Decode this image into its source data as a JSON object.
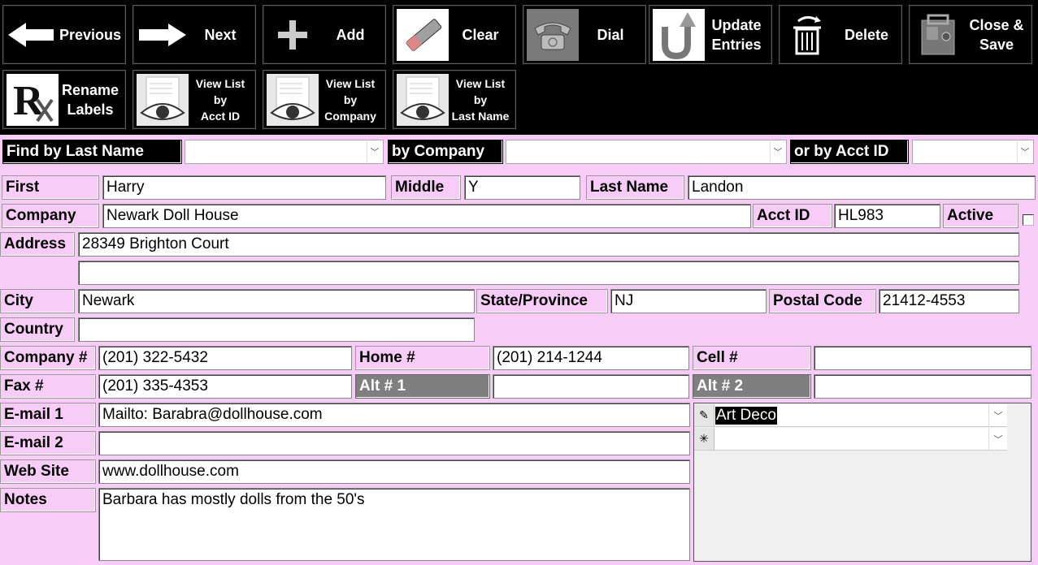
{
  "toolbar": {
    "previous": "Previous",
    "next": "Next",
    "add": "Add",
    "clear": "Clear",
    "dial": "Dial",
    "update": "Update\nEntries",
    "delete": "Delete",
    "close_save": "Close &\nSave",
    "rename": "Rename\nLabels",
    "view_acct": "View List\nby\nAcct ID",
    "view_company": "View List\nby\nCompany",
    "view_last": "View List\nby\nLast Name"
  },
  "find": {
    "by_last_label": "Find by Last Name",
    "by_company_label": "by Company",
    "by_acct_label": "or by Acct ID"
  },
  "labels": {
    "first": "First",
    "middle": "Middle",
    "last": "Last Name",
    "company": "Company",
    "acct_id": "Acct ID",
    "active": "Active",
    "address": "Address",
    "city": "City",
    "state": "State/Province",
    "postal": "Postal Code",
    "country": "Country",
    "company_phone": "Company #",
    "home_phone": "Home #",
    "cell_phone": "Cell #",
    "fax": "Fax #",
    "alt1": "Alt # 1",
    "alt2": "Alt # 2",
    "email1": "E-mail 1",
    "email2": "E-mail 2",
    "website": "Web Site",
    "notes": "Notes"
  },
  "values": {
    "first": "Harry",
    "middle": "Y",
    "last": "Landon",
    "company": "Newark Doll House",
    "acct_id": "HL983",
    "active": false,
    "address1": "28349 Brighton Court",
    "address2": "",
    "city": "Newark",
    "state": "NJ",
    "postal": "21412-4553",
    "country": "",
    "company_phone": "(201) 322-5432",
    "home_phone": "(201) 214-1244",
    "cell_phone": "",
    "fax": "(201) 335-4353",
    "alt1": "",
    "alt2": "",
    "email1": "Mailto: Barabra@dollhouse.com",
    "email2": "",
    "website": "www.dollhouse.com",
    "notes": "Barbara has mostly dolls from the 50's"
  },
  "categories": {
    "rows": [
      {
        "selector": "✎",
        "value": "Art Deco"
      },
      {
        "selector": "✳",
        "value": ""
      }
    ]
  },
  "colors": {
    "background": "#f7cdf7",
    "toolbar": "#000000",
    "grey_label": "#7f7f7f"
  }
}
